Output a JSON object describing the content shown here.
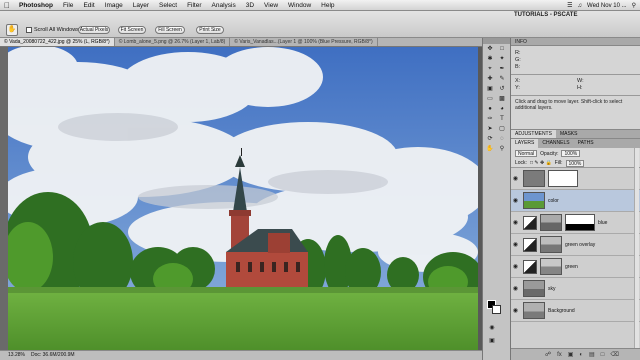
{
  "menubar": {
    "apple": "",
    "items": [
      "Photoshop",
      "File",
      "Edit",
      "Image",
      "Layer",
      "Select",
      "Filter",
      "Analysis",
      "3D",
      "View",
      "Window",
      "Help"
    ],
    "clock": "Wed Nov 10 ..."
  },
  "workspace": {
    "label": "TUTORIALS - PSCATE"
  },
  "options": {
    "sample_all_layers": "Scroll All Windows",
    "buttons": [
      "Actual Pixels",
      "Fit Screen",
      "Fill Screen",
      "Print Size"
    ]
  },
  "doc_tabs": [
    "© Vada_20080722_422.jpg @ 25% (L, RGB/8*)",
    "© Lomb_alone_5.png @ 26.7% (Layer 1, Lab/8)",
    "© Varis_Vanadlas...(Layer 1 @ 100% (Blue Pressure, RGB/8*)"
  ],
  "status": {
    "zoom": "13.28%",
    "doc": "Doc: 36.6M/200.9M"
  },
  "info_panel": {
    "title": "INFO",
    "labels": [
      "R:",
      "G:",
      "B:",
      "X:",
      "Y:",
      "W:",
      "H:"
    ],
    "note": "Click and drag to move layer. Shift-click to select additional layers."
  },
  "adj_tabs": [
    "ADJUSTMENTS",
    "MASKS"
  ],
  "layers_tabs": [
    "LAYERS",
    "CHANNELS",
    "PATHS"
  ],
  "blend": {
    "mode": "Normal",
    "opacity_label": "Opacity:",
    "opacity": "100%"
  },
  "lock": {
    "label": "Lock:",
    "fill_label": "Fill:",
    "fill": "100%"
  },
  "layers": [
    {
      "name": "",
      "type": "mask"
    },
    {
      "name": "color",
      "type": "image"
    },
    {
      "name": "blue",
      "type": "adjust"
    },
    {
      "name": "green overlay",
      "type": "image"
    },
    {
      "name": "green",
      "type": "image"
    },
    {
      "name": "sky",
      "type": "image"
    },
    {
      "name": "Background",
      "type": "image"
    }
  ],
  "colors": {
    "sky": "#4a78c8",
    "grass": "#63a53a",
    "church": "#b14a3c"
  }
}
